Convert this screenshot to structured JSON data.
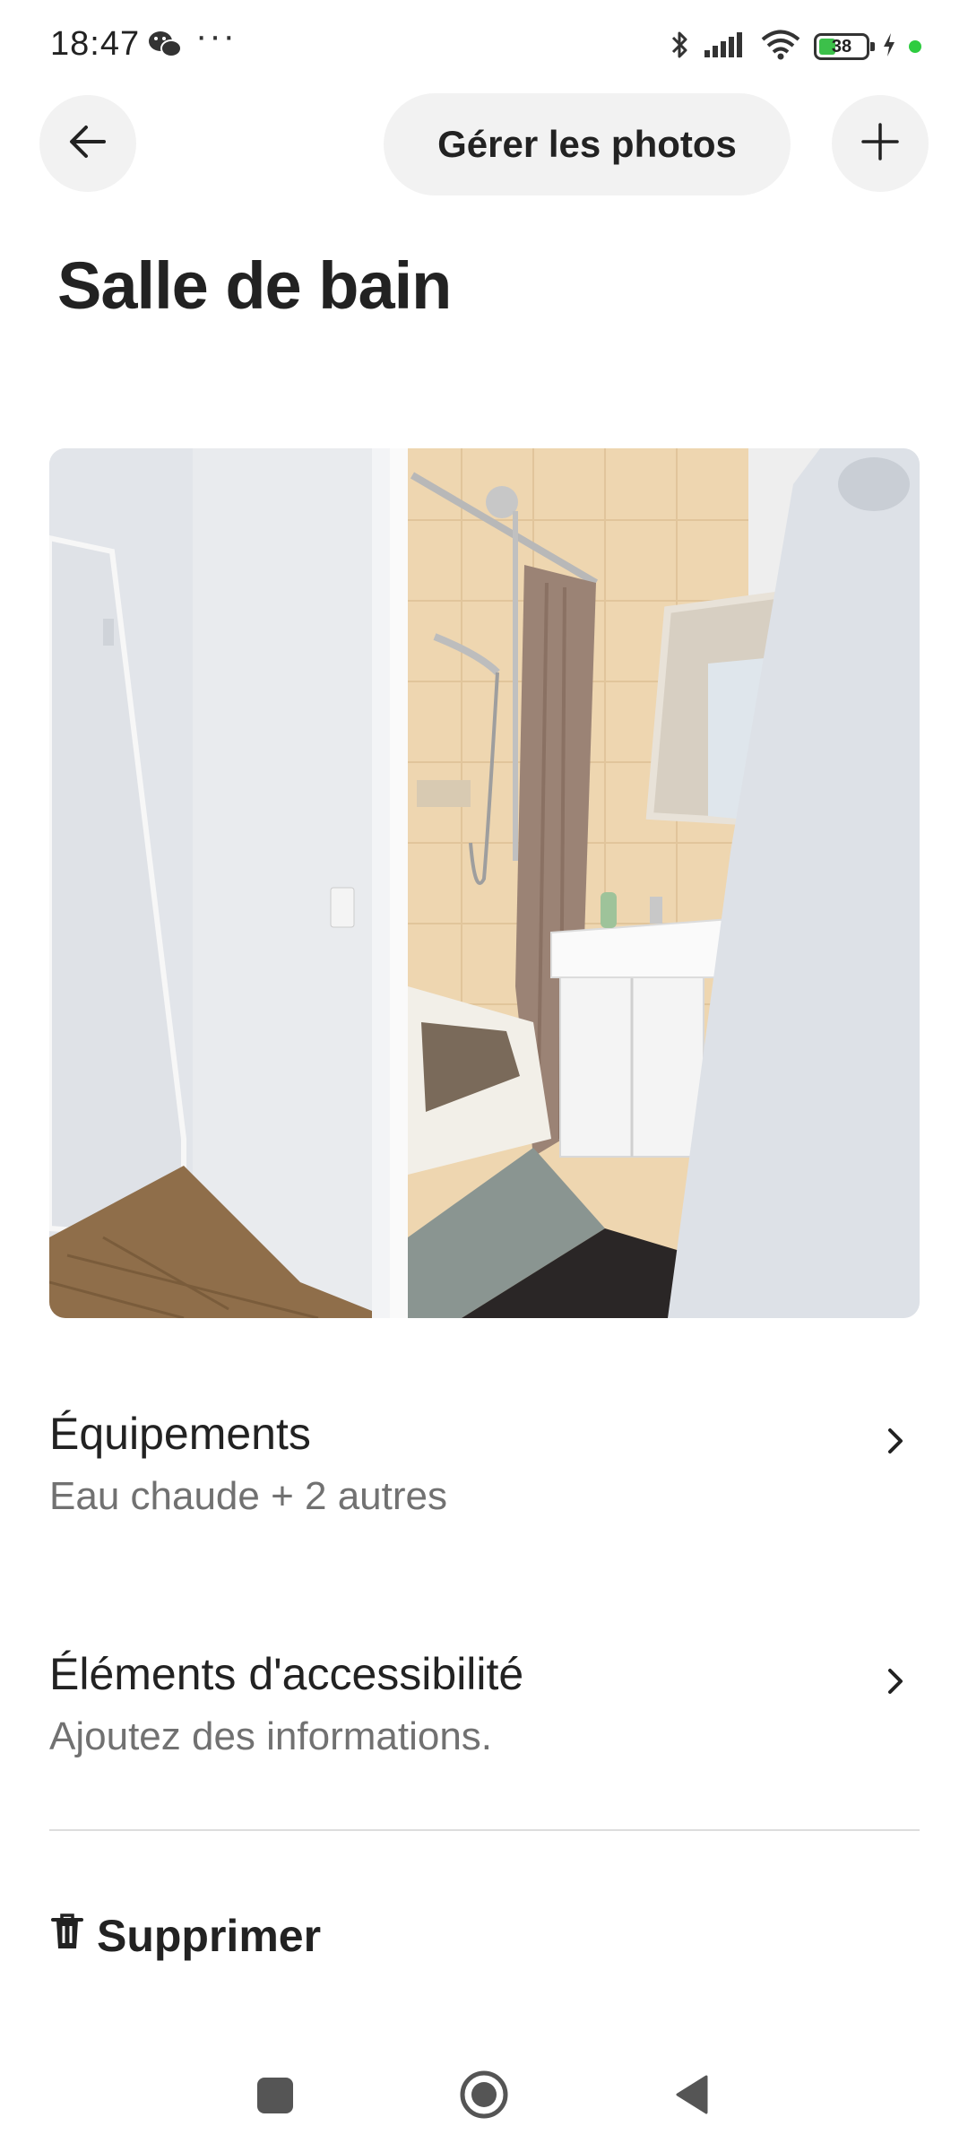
{
  "status_bar": {
    "time": "18:47",
    "more": "···",
    "battery": "38",
    "icons": [
      "wechat-icon",
      "bluetooth-icon",
      "signal-icon",
      "wifi-icon",
      "battery-icon",
      "charging-icon"
    ]
  },
  "header": {
    "manage_photos_label": "Gérer les photos"
  },
  "page": {
    "title": "Salle de bain"
  },
  "photo": {
    "subject": "bathroom-photo"
  },
  "sections": [
    {
      "title": "Équipements",
      "subtitle": "Eau chaude + 2 autres"
    },
    {
      "title": "Éléments d'accessibilité",
      "subtitle": "Ajoutez des informations."
    }
  ],
  "actions": {
    "delete_label": "Supprimer"
  },
  "colors": {
    "text": "#222222",
    "muted": "#717171",
    "button_bg": "#f2f2f2",
    "divider": "#dddddd",
    "battery_fill": "#3cc04a"
  }
}
